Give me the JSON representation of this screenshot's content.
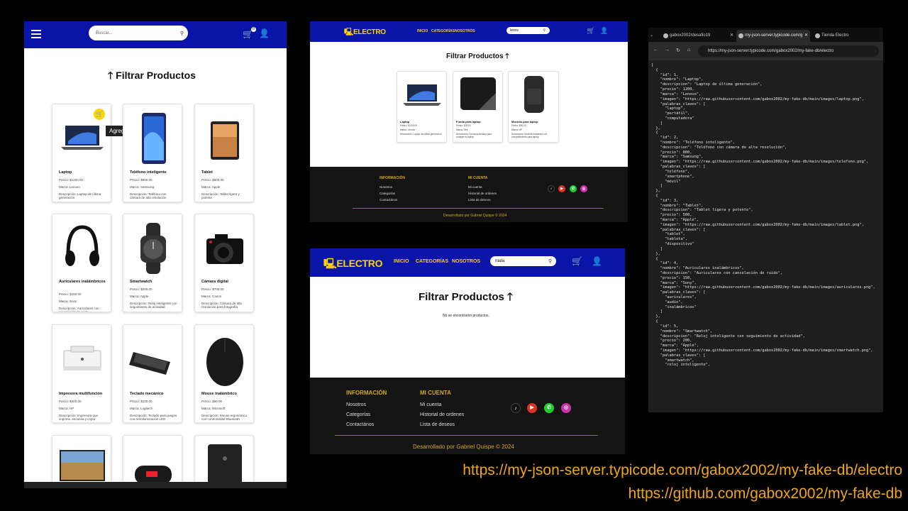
{
  "mobile": {
    "search_placeholder": "Buscar...",
    "cart_count": "0",
    "title": "🡑 Filtrar Productos",
    "tooltip": "Agregar al carrito",
    "products": [
      {
        "name": "Laptop",
        "price": "Precio: $1200.00",
        "brand": "Marca: Lenovo",
        "desc": "Descripción: Laptop de última generación"
      },
      {
        "name": "Teléfono inteligente",
        "price": "Precio: $800.00",
        "brand": "Marca: Samsung",
        "desc": "Descripción: Teléfono con cámara de alta resolución"
      },
      {
        "name": "Tablet",
        "price": "Precio: $500.00",
        "brand": "Marca: Apple",
        "desc": "Descripción: Tablet ligera y potente"
      },
      {
        "name": "Auriculares inalámbricos",
        "price": "Precio: $150.00",
        "brand": "Marca: Sony",
        "desc": "Descripción: Auriculares con cancelación de ruido"
      },
      {
        "name": "Smartwatch",
        "price": "Precio: $200.00",
        "brand": "Marca: Apple",
        "desc": "Descripción: Reloj inteligente con seguimiento de actividad"
      },
      {
        "name": "Cámara digital",
        "price": "Precio: $700.00",
        "brand": "Marca: Canon",
        "desc": "Descripción: Cámara de alta resolución para fotografía"
      },
      {
        "name": "Impresora multifunción",
        "price": "Precio: $300.00",
        "brand": "Marca: HP",
        "desc": "Descripción: Impresora que imprime, escanea y copia"
      },
      {
        "name": "Teclado mecánico",
        "price": "Precio: $100.00",
        "brand": "Marca: Logitech",
        "desc": "Descripción: Teclado para juegos con retroiluminación LED"
      },
      {
        "name": "Mouse inalámbrico",
        "price": "Precio: $50.00",
        "brand": "Marca: Microsoft",
        "desc": "Descripción: Mouse ergonómico con conectividad Bluetooth"
      }
    ]
  },
  "desktop_results": {
    "logo": "ELECTRO",
    "nav": [
      "INICIO",
      "CATEGORÍAS",
      "NOSOTROS"
    ],
    "search_value": "lenov",
    "title": "Filtrar Productos 🡑",
    "products": [
      {
        "name": "Laptop",
        "price": "Precio: $1200.00",
        "brand": "Marca: Lenovo",
        "desc": "Descripción: Laptop de última generación"
      },
      {
        "name": "Funda para laptop",
        "price": "Precio: $25.00",
        "brand": "Marca: Dell",
        "desc": "Descripción: Funda acolchada para proteger tu laptop"
      },
      {
        "name": "Mochila para laptop",
        "price": "Precio: $50.00",
        "brand": "Marca: HP",
        "desc": "Descripción: Mochila resistente con compartimiento para laptop"
      }
    ]
  },
  "desktop_empty": {
    "search_value": "nada",
    "title": "Filtrar Productos 🡑",
    "empty_msg": "No se encontraron productos."
  },
  "footer": {
    "info_heading": "INFORMACIÓN",
    "info_links": [
      "Nosotros",
      "Categorías",
      "Contactános"
    ],
    "account_heading": "MI CUENTA",
    "account_links": [
      "Mi cuenta",
      "Historial de ordenes",
      "Lista de deseos"
    ],
    "copyright": "Desarrollado por Gabriel Quispe © 2024"
  },
  "browser": {
    "tabs": [
      "gabox2002/desafio19",
      "my-json-server.typicode.com/g",
      "Tienda Electro"
    ],
    "url": "https://my-json-server.typicode.com/gabox2002/my-fake-db/electro",
    "json_text": "[\n  {\n    \"id\": 1,\n    \"nombre\": \"Laptop\",\n    \"descripcion\": \"Laptop de última generación\",\n    \"precio\": 1200,\n    \"marca\": \"Lenovo\",\n    \"imagen\": \"https://raw.githubusercontent.com/gabox2002/my-fake-db/main/images/laptop.png\",\n    \"palabras_claves\": [\n      \"laptop\",\n      \"portátil\",\n      \"computadora\"\n    ]\n  },\n  {\n    \"id\": 2,\n    \"nombre\": \"Teléfono inteligente\",\n    \"descripcion\": \"Teléfono con cámara de alta resolución\",\n    \"precio\": 800,\n    \"marca\": \"Samsung\",\n    \"imagen\": \"https://raw.githubusercontent.com/gabox2002/my-fake-db/main/images/telefono.png\",\n    \"palabras_claves\": [\n      \"teléfono\",\n      \"smartphone\",\n      \"móvil\"\n    ]\n  },\n  {\n    \"id\": 3,\n    \"nombre\": \"Tablet\",\n    \"descripcion\": \"Tablet ligera y potente\",\n    \"precio\": 500,\n    \"marca\": \"Apple\",\n    \"imagen\": \"https://raw.githubusercontent.com/gabox2002/my-fake-db/main/images/tablet.png\",\n    \"palabras_claves\": [\n      \"tablet\",\n      \"tableta\",\n      \"dispositivo\"\n    ]\n  },\n  {\n    \"id\": 4,\n    \"nombre\": \"Auriculares inalámbricos\",\n    \"descripcion\": \"Auriculares con cancelación de ruido\",\n    \"precio\": 150,\n    \"marca\": \"Sony\",\n    \"imagen\": \"https://raw.githubusercontent.com/gabox2002/my-fake-db/main/images/auriculares.png\",\n    \"palabras_claves\": [\n      \"auriculares\",\n      \"audio\",\n      \"inalámbricos\"\n    ]\n  },\n  {\n    \"id\": 5,\n    \"nombre\": \"Smartwatch\",\n    \"descripcion\": \"Reloj inteligente con seguimiento de actividad\",\n    \"precio\": 200,\n    \"marca\": \"Apple\",\n    \"imagen\": \"https://raw.githubusercontent.com/gabox2002/my-fake-db/main/images/smartwatch.png\",\n    \"palabras_claves\": [\n      \"smartwatch\",\n      \"reloj inteligente\","
  },
  "links": {
    "json_server": "https://my-json-server.typicode.com/gabox2002/my-fake-db/electro",
    "github": "https://github.com/gabox2002/my-fake-db"
  },
  "colors": {
    "nav_blue": "#0a14a8",
    "accent_yellow": "#ffd400",
    "footer_gold": "#d7a91a",
    "link_orange": "#f0a515"
  }
}
